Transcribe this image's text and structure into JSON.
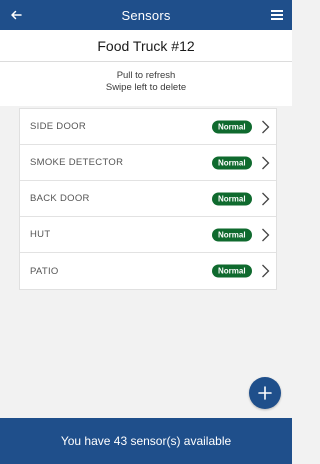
{
  "header": {
    "title": "Sensors",
    "back_icon": "arrow-left-icon",
    "menu_icon": "hamburger-menu-icon"
  },
  "location": {
    "title": "Food Truck #12"
  },
  "info": {
    "line1": "Pull to refresh",
    "line2": "Swipe left to delete"
  },
  "sensors": [
    {
      "name": "SIDE DOOR",
      "status": "Normal"
    },
    {
      "name": "SMOKE DETECTOR",
      "status": "Normal"
    },
    {
      "name": "BACK DOOR",
      "status": "Normal"
    },
    {
      "name": "HUT",
      "status": "Normal"
    },
    {
      "name": "PATIO",
      "status": "Normal"
    }
  ],
  "fab": {
    "icon": "plus-icon"
  },
  "footer": {
    "text": "You have 43 sensor(s) available"
  },
  "colors": {
    "primary": "#1f4f8b",
    "status_normal": "#0f6a2e",
    "background": "#f2f2f2"
  }
}
